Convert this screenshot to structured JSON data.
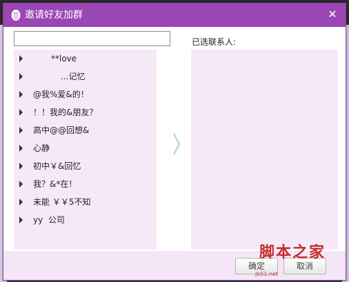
{
  "window": {
    "title": "邀请好友加群",
    "close_glyph": "✕"
  },
  "search": {
    "value": "",
    "placeholder": ""
  },
  "friend_groups": [
    {
      "name": "**love",
      "redacted_prefix": true
    },
    {
      "name": "...记忆",
      "redacted_prefix": true
    },
    {
      "name": "@我%爱&的！"
    },
    {
      "name": "！！我的&朋友？"
    },
    {
      "name": "高中@@回想&"
    },
    {
      "name": "心静"
    },
    {
      "name": "初中￥&回忆"
    },
    {
      "name": "我？&*在！"
    },
    {
      "name": "未能 ￥￥5不知"
    },
    {
      "name": "yy  公司"
    }
  ],
  "selected_panel": {
    "label": "已选联系人:",
    "items": []
  },
  "footer": {
    "confirm_label": "确定",
    "cancel_label": "取消"
  },
  "watermark": {
    "text": "脚本之家",
    "url": "jb51.net"
  },
  "colors": {
    "titlebar": "#9a46b5",
    "panel_bg": "#f6e9f7",
    "watermark": "#c01818"
  },
  "icons": {
    "logo": "penguin-icon",
    "close": "close-icon",
    "expand": "triangle-right-icon",
    "transfer": "chevron-right-icon"
  }
}
